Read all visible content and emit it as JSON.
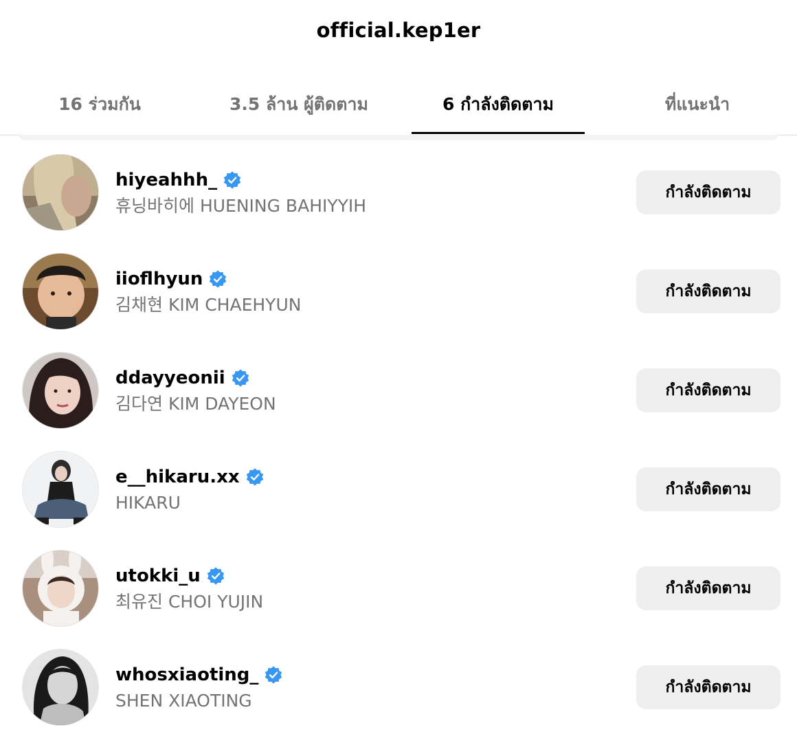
{
  "header": {
    "title": "official.kep1er"
  },
  "tabs": [
    {
      "label": "16 ร่วมกัน",
      "active": false
    },
    {
      "label": "3.5 ล้าน ผู้ติดตาม",
      "active": false
    },
    {
      "label": "6 กำลังติดตาม",
      "active": true
    },
    {
      "label": "ที่แนะนำ",
      "active": false
    }
  ],
  "accounts": [
    {
      "username": "hiyeahhh_",
      "full_name": "휴닝바히에 HUENING BAHIYYIH",
      "verified": true,
      "button_label": "กำลังติดตาม",
      "avatar_icon": "profile-photo-blonde-hair"
    },
    {
      "username": "iioflhyun",
      "full_name": "김채현 KIM CHAEHYUN",
      "verified": true,
      "button_label": "กำลังติดตาม",
      "avatar_icon": "profile-photo-child"
    },
    {
      "username": "ddayyeonii",
      "full_name": "김다연 KIM DAYEON",
      "verified": true,
      "button_label": "กำลังติดตาม",
      "avatar_icon": "profile-photo-dark-hair"
    },
    {
      "username": "e__hikaru.xx",
      "full_name": "HIKARU",
      "verified": true,
      "button_label": "กำลังติดตาม",
      "avatar_icon": "profile-photo-sitting"
    },
    {
      "username": "utokki_u",
      "full_name": "최유진 CHOI YUJIN",
      "verified": true,
      "button_label": "กำลังติดตาม",
      "avatar_icon": "profile-photo-bunny-hood"
    },
    {
      "username": "whosxiaoting_",
      "full_name": "SHEN XIAOTING",
      "verified": true,
      "button_label": "กำลังติดตาม",
      "avatar_icon": "profile-photo-monochrome"
    }
  ],
  "colors": {
    "verified_badge": "#3897f0",
    "secondary_text": "#737373",
    "button_bg": "#efefef",
    "divider": "#dbdbdb"
  }
}
